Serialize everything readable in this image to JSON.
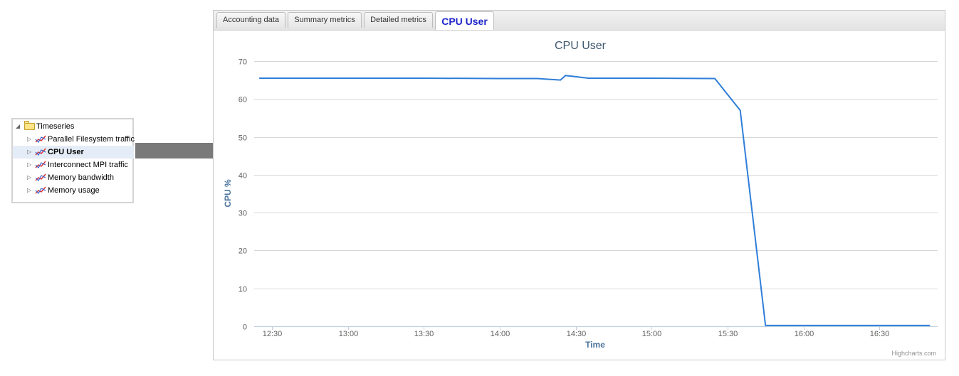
{
  "tree": {
    "root_label": "Timeseries",
    "items": [
      {
        "label": "Parallel Filesystem traffic",
        "selected": false
      },
      {
        "label": "CPU User",
        "selected": true
      },
      {
        "label": "Interconnect MPI traffic",
        "selected": false
      },
      {
        "label": "Memory bandwidth",
        "selected": false
      },
      {
        "label": "Memory usage",
        "selected": false
      }
    ]
  },
  "tabs": [
    {
      "label": "Accounting data",
      "active": false
    },
    {
      "label": "Summary metrics",
      "active": false
    },
    {
      "label": "Detailed metrics",
      "active": false
    },
    {
      "label": "CPU User",
      "active": true
    }
  ],
  "credits": "Highcharts.com",
  "colors": {
    "series": "#2f7ed8",
    "arrow": "#7a7a7a",
    "active_tab": "#1f25c9"
  },
  "chart_data": {
    "type": "line",
    "title": "CPU User",
    "xlabel": "Time",
    "ylabel": "CPU %",
    "ylim": [
      0,
      70
    ],
    "yticks": [
      0,
      10,
      20,
      30,
      40,
      50,
      60,
      70
    ],
    "xlim": [
      "12:23",
      "16:53"
    ],
    "xticks": [
      "12:30",
      "13:00",
      "13:30",
      "14:00",
      "14:30",
      "15:00",
      "15:30",
      "16:00",
      "16:30"
    ],
    "grid": true,
    "legend": false,
    "series": [
      {
        "x": [
          "12:25",
          "13:00",
          "13:30",
          "14:00",
          "14:15",
          "14:24",
          "14:26",
          "14:35",
          "15:00",
          "15:25",
          "15:35",
          "15:45",
          "16:00",
          "16:30",
          "16:50"
        ],
        "y": [
          65.5,
          65.5,
          65.5,
          65.4,
          65.4,
          65.0,
          66.2,
          65.5,
          65.5,
          65.4,
          57.0,
          0.2,
          0.2,
          0.2,
          0.2
        ]
      }
    ]
  }
}
